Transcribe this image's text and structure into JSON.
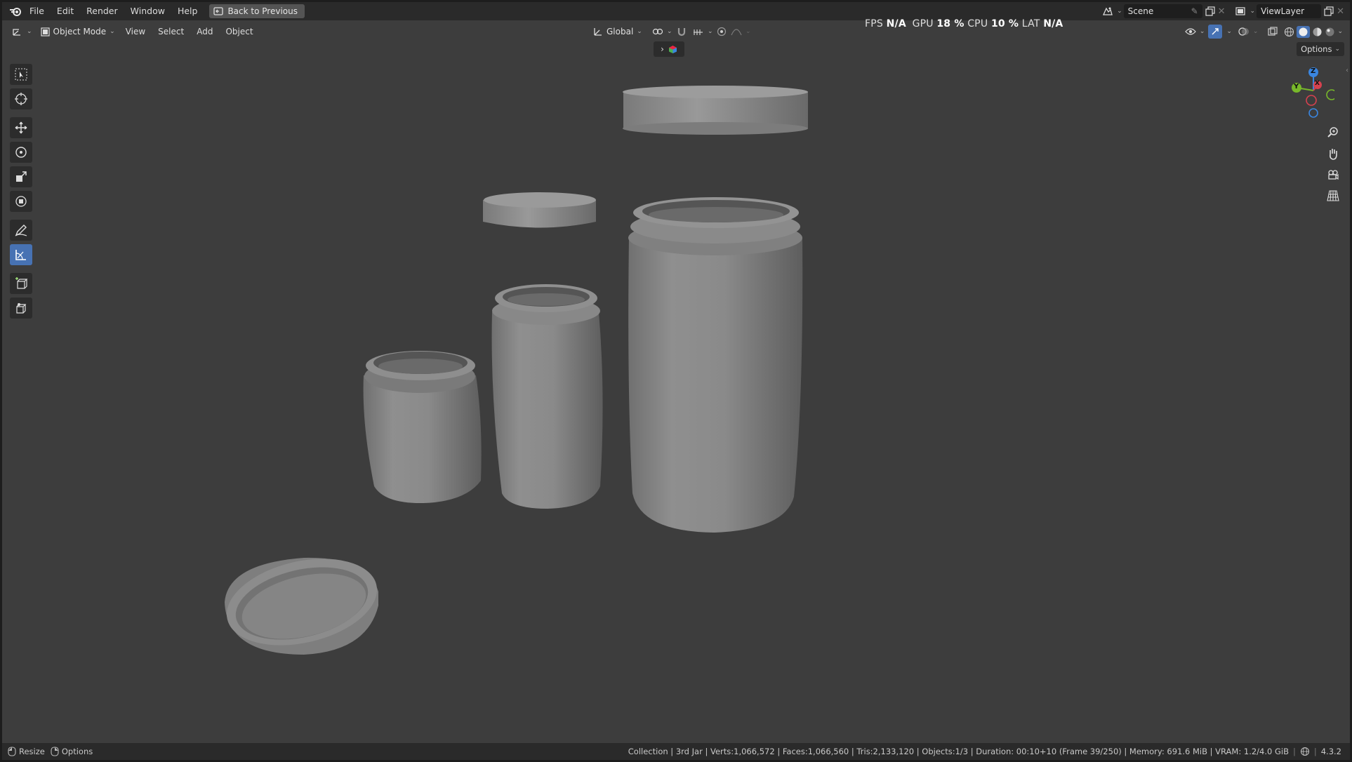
{
  "menu": {
    "file": "File",
    "edit": "Edit",
    "render": "Render",
    "window": "Window",
    "help": "Help",
    "back_button": "Back to Previous"
  },
  "scene": {
    "scene_name": "Scene",
    "view_layer": "ViewLayer"
  },
  "header": {
    "mode": "Object Mode",
    "view": "View",
    "select": "Select",
    "add": "Add",
    "object": "Object",
    "orientation": "Global",
    "options": "Options"
  },
  "perf": {
    "fps_label": "FPS",
    "fps_value": "N/A",
    "gpu_label": "GPU",
    "gpu_value": "18 %",
    "cpu_label": "CPU",
    "cpu_value": "10 %",
    "lat_label": "LAT",
    "lat_value": "N/A"
  },
  "gizmo": {
    "z": "Z",
    "y": "Y",
    "x": "X"
  },
  "status": {
    "resize": "Resize",
    "options": "Options",
    "info": "Collection | 3rd Jar | Verts:1,066,572 | Faces:1,066,560 | Tris:2,133,120 | Objects:1/3 | Duration: 00:10+10 (Frame 39/250) | Memory: 691.6 MiB | VRAM: 1.2/4.0 GiB",
    "version": "4.3.2"
  },
  "colors": {
    "viewport": "#3d3d3d",
    "header": "#2a2a2a",
    "accent": "#4772b3",
    "axis_x": "#d6414f",
    "axis_y": "#78b82a",
    "axis_z": "#3a86e0"
  }
}
